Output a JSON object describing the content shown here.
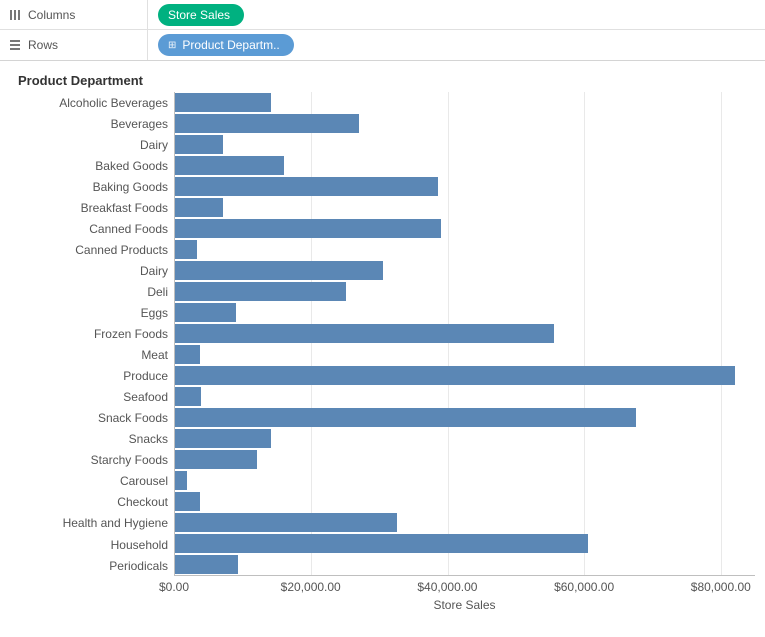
{
  "shelves": {
    "columns_label": "Columns",
    "rows_label": "Rows",
    "columns_pill": "Store Sales",
    "rows_pill": "Product Departm.."
  },
  "chart_data": {
    "type": "bar",
    "title": "Product Department",
    "xlabel": "Store Sales",
    "ylabel": "",
    "xlim": [
      0,
      85000
    ],
    "categories": [
      "Alcoholic Beverages",
      "Beverages",
      "Dairy",
      "Baked Goods",
      "Baking Goods",
      "Breakfast Foods",
      "Canned Foods",
      "Canned Products",
      "Dairy",
      "Deli",
      "Eggs",
      "Frozen Foods",
      "Meat",
      "Produce",
      "Seafood",
      "Snack Foods",
      "Snacks",
      "Starchy Foods",
      "Carousel",
      "Checkout",
      "Health and Hygiene",
      "Household",
      "Periodicals"
    ],
    "values": [
      14000,
      27000,
      7000,
      16000,
      38500,
      7000,
      39000,
      3200,
      30500,
      25000,
      9000,
      55500,
      3700,
      82000,
      3800,
      67500,
      14000,
      12000,
      1700,
      3700,
      32500,
      60500,
      9200
    ],
    "xticks": [
      0,
      20000,
      40000,
      60000,
      80000
    ],
    "xtick_labels": [
      "$0.00",
      "$20,000.00",
      "$40,000.00",
      "$60,000.00",
      "$80,000.00"
    ]
  },
  "colors": {
    "bar": "#5b87b5",
    "pill_measure": "#00b180",
    "pill_dimension": "#5b9bd5"
  }
}
